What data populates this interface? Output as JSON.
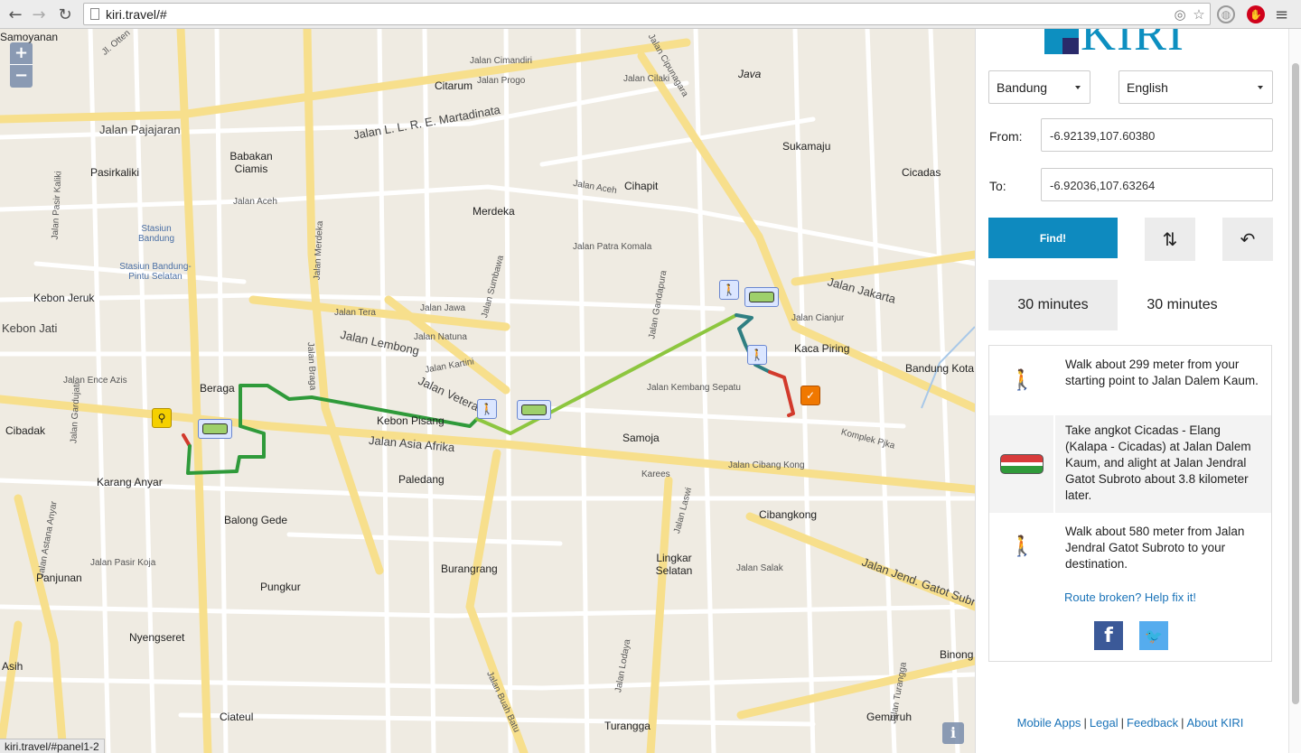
{
  "browser": {
    "url": "kiri.travel/#",
    "status_url": "kiri.travel/#panel1-2"
  },
  "map": {
    "zoom_in": "+",
    "zoom_out": "−",
    "info": "i",
    "labels": {
      "otten": "Jl. Otten",
      "samoyanan": "Samoyanan",
      "cipunagara": "Jalan Cipunagara",
      "java": "Java",
      "citarum": "Citarum",
      "progo": "Jalan Progo",
      "cimandiri": "Jalan Cimandiri",
      "cilaki": "Jalan Cilaki",
      "martadinata": "Jalan L. L. R. E. Martadinata",
      "pajajaran": "Jalan Pajajaran",
      "babakan_ciamis": "Babakan Ciamis",
      "pasirkaliki": "Pasirkaliki",
      "sukamaju": "Sukamaju",
      "cicadas": "Cicadas",
      "cihapit": "Cihapit",
      "merdeka": "Merdeka",
      "aceh": "Jalan Aceh",
      "stasiun_bandung": "Stasiun Bandung",
      "stasiun_pintu": "Stasiun Bandung-Pintu Selatan",
      "kebon_jeruk": "Kebon Jeruk",
      "kebon_jati": "Kebon Jati",
      "jakarta": "Jalan Jakarta",
      "kaca_piring": "Kaca Piring",
      "bandung_kota": "Bandung Kota",
      "lembong": "Jalan Lembong",
      "beraga": "Beraga",
      "kebon_pisang": "Kebon Pisang",
      "asia_afrika": "Jalan Asia Afrika",
      "samoja": "Samoja",
      "cibadak": "Cibadak",
      "karang_anyar": "Karang Anyar",
      "paledang": "Paledang",
      "balong_gede": "Balong Gede",
      "cibangkong": "Cibangkong",
      "pasir_koja": "Jalan Pasir Koja",
      "panjunan": "Panjunan",
      "pungkur": "Pungkur",
      "lingkar_selatan": "Lingkar Selatan",
      "burangrang": "Burangrang",
      "nyengseret": "Nyengseret",
      "asih": "Asih",
      "ciateul": "Ciateul",
      "turangga": "Turangga",
      "gemuruh": "Gemuruh",
      "binong": "Binong",
      "gatot_subroto": "Jalan Jend. Gatot Subroto",
      "karees": "Karees",
      "komplek_pjka": "Komplek Pjka",
      "laswi": "Jalan Laswi",
      "braga": "Jalan Braga",
      "merdeka_road": "Jalan Merdeka",
      "veteran": "Jalan Veteran",
      "kembang_sepatu": "Jalan Kembang Sepatu",
      "cibang_kong": "Jalan Cibang Kong",
      "buah_batu": "Jalan Buah Batu",
      "lodaya": "Jalan Lodaya",
      "astana_anyar": "Jalan Astana Anyar",
      "gardujati": "Jalan Gardujati",
      "pasir_kaliki_road": "Jalan Pasir Kaliki",
      "sumbawa": "Jalan Sumbawa",
      "gandapura": "Jalan Gandapura",
      "tera": "Jalan Tera",
      "jawa": "Jalan Jawa",
      "natuna": "Jalan Natuna",
      "kartini": "Jalan Kartini",
      "cianjur": "Jalan Cianjur",
      "patra_komala": "Jalan Patra Komala",
      "salak": "Jalan Salak",
      "turangga_road": "Jalan Turangga",
      "ence_azis": "Jalan Ence Azis"
    }
  },
  "panel": {
    "logo_text": "KIRI",
    "city": "Bandung",
    "language": "English",
    "from_label": "From:",
    "from_value": "-6.92139,107.60380",
    "to_label": "To:",
    "to_value": "-6.92036,107.63264",
    "find_label": "Find!",
    "swap_icon": "swap-icon",
    "reset_icon": "undo-icon",
    "tabs": [
      {
        "label": "30 minutes",
        "active": true
      },
      {
        "label": "30 minutes",
        "active": false
      }
    ],
    "steps": [
      {
        "icon": "walk-icon",
        "text": "Walk about 299 meter from your starting point to Jalan Dalem Kaum."
      },
      {
        "icon": "angkot-icon",
        "text": "Take angkot Cicadas - Elang (Kalapa - Cicadas) at Jalan Dalem Kaum, and alight at Jalan Jendral Gatot Subroto about 3.8 kilometer later."
      },
      {
        "icon": "walk-icon",
        "text": "Walk about 580 meter from Jalan Jendral Gatot Subroto to your destination."
      }
    ],
    "help_link": "Route broken? Help fix it!",
    "footer": {
      "mobile_apps": "Mobile Apps",
      "legal": "Legal",
      "feedback": "Feedback",
      "about": "About KIRI",
      "separator": "|"
    }
  },
  "colors": {
    "accent": "#0e8abf",
    "route_walk": "#d23a2c",
    "route_angkot": "#2f9a3a",
    "route_angkot_light": "#8dc63f"
  }
}
